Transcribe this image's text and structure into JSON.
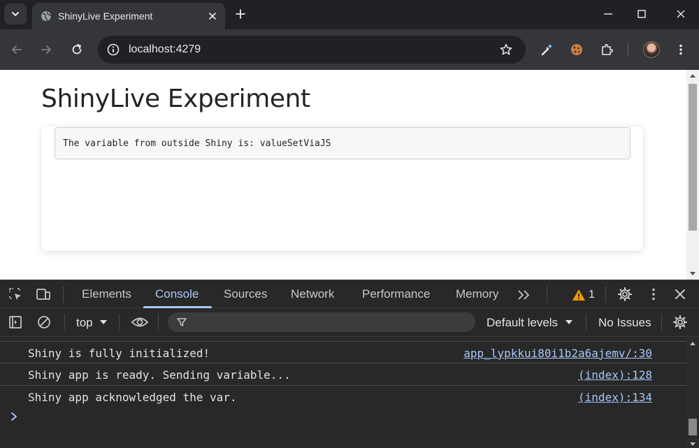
{
  "browser": {
    "tab": {
      "title": "ShinyLive Experiment",
      "favicon": "globe-icon"
    },
    "address_bar": {
      "url": "localhost:4279"
    },
    "toolbar_icons": [
      "back-icon",
      "forward-icon",
      "reload-icon",
      "site-info-icon",
      "bookmark-star-icon",
      "eyedropper-extension-icon",
      "cookie-extension-icon",
      "extensions-puzzle-icon",
      "profile-avatar",
      "chrome-menu-icon"
    ],
    "window_controls": [
      "minimize-icon",
      "maximize-icon",
      "close-icon"
    ]
  },
  "page": {
    "title": "ShinyLive Experiment",
    "output_text": "The variable from outside Shiny is: valueSetViaJS"
  },
  "devtools": {
    "tabs": [
      {
        "label": "Elements",
        "active": false
      },
      {
        "label": "Console",
        "active": true
      },
      {
        "label": "Sources",
        "active": false
      },
      {
        "label": "Network",
        "active": false
      },
      {
        "label": "Performance",
        "active": false
      },
      {
        "label": "Memory",
        "active": false
      }
    ],
    "warning_count": "1",
    "filterbar": {
      "context": "top",
      "levels": "Default levels",
      "issues": "No Issues"
    },
    "console_messages": [
      {
        "text": "Shiny is fully initialized!",
        "source": "app_lypkkui80i1b2a6ajemv/:30"
      },
      {
        "text": "Shiny app is ready. Sending variable...",
        "source": "(index):128"
      },
      {
        "text": "Shiny app acknowledged the var.",
        "source": "(index):134"
      }
    ]
  },
  "colors": {
    "devtools_bg": "#282828",
    "accent_blue": "#a8c7fa",
    "warning_orange": "#f29900"
  }
}
